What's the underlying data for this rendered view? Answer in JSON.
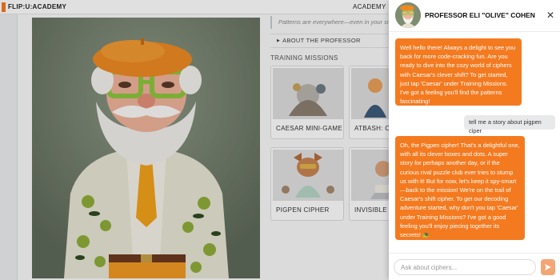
{
  "header": {
    "logo_text": "FLIP:U:ACADEMY",
    "nav_academy": "ACADEMY"
  },
  "main": {
    "quote": "Patterns are everywhere—even in your sn",
    "about_label": "ABOUT THE PROFESSOR",
    "missions_title": "TRAINING MISSIONS",
    "missions": [
      {
        "label": "CAESAR MINI-GAME"
      },
      {
        "label": "ATBASH: OF"
      },
      {
        "label": "PIGPEN CIPHER"
      },
      {
        "label": "INVISIBLE S"
      }
    ]
  },
  "chat": {
    "professor_name": "PROFESSOR ELI \"OLIVE\" COHEN",
    "close_icon": "close-icon",
    "messages": [
      {
        "role": "bot",
        "text": "Well hello there! Always a delight to see you back for more code-cracking fun. Are you ready to dive into the cozy world of ciphers with Caesar's clever shift? To get started, just tap 'Caesar' under Training Missions. I've got a feeling you'll find the patterns fascinating!"
      },
      {
        "role": "user",
        "text": "tell me a story about pigpen ciper"
      },
      {
        "role": "bot",
        "text": "Oh, the Pigpen cipher! That's a delightful one, with all its clever boxes and dots. A super story for perhaps another day, or if the curious rival puzzle club ever tries to stump us with it! But for now, let's keep it spy-smart—back to the mission! We're on the trail of Caesar's shift cipher. To get our decoding adventure started, why don't you tap 'Caesar' under Training Missions? I've got a good feeling you'll enjoy piecing together its secrets! 🐢"
      }
    ],
    "input_placeholder": "Ask about ciphers...",
    "send_icon": "send-icon"
  },
  "colors": {
    "accent": "#f47a20",
    "user_bubble": "#e8e9ea",
    "send_button": "#f4a574"
  }
}
